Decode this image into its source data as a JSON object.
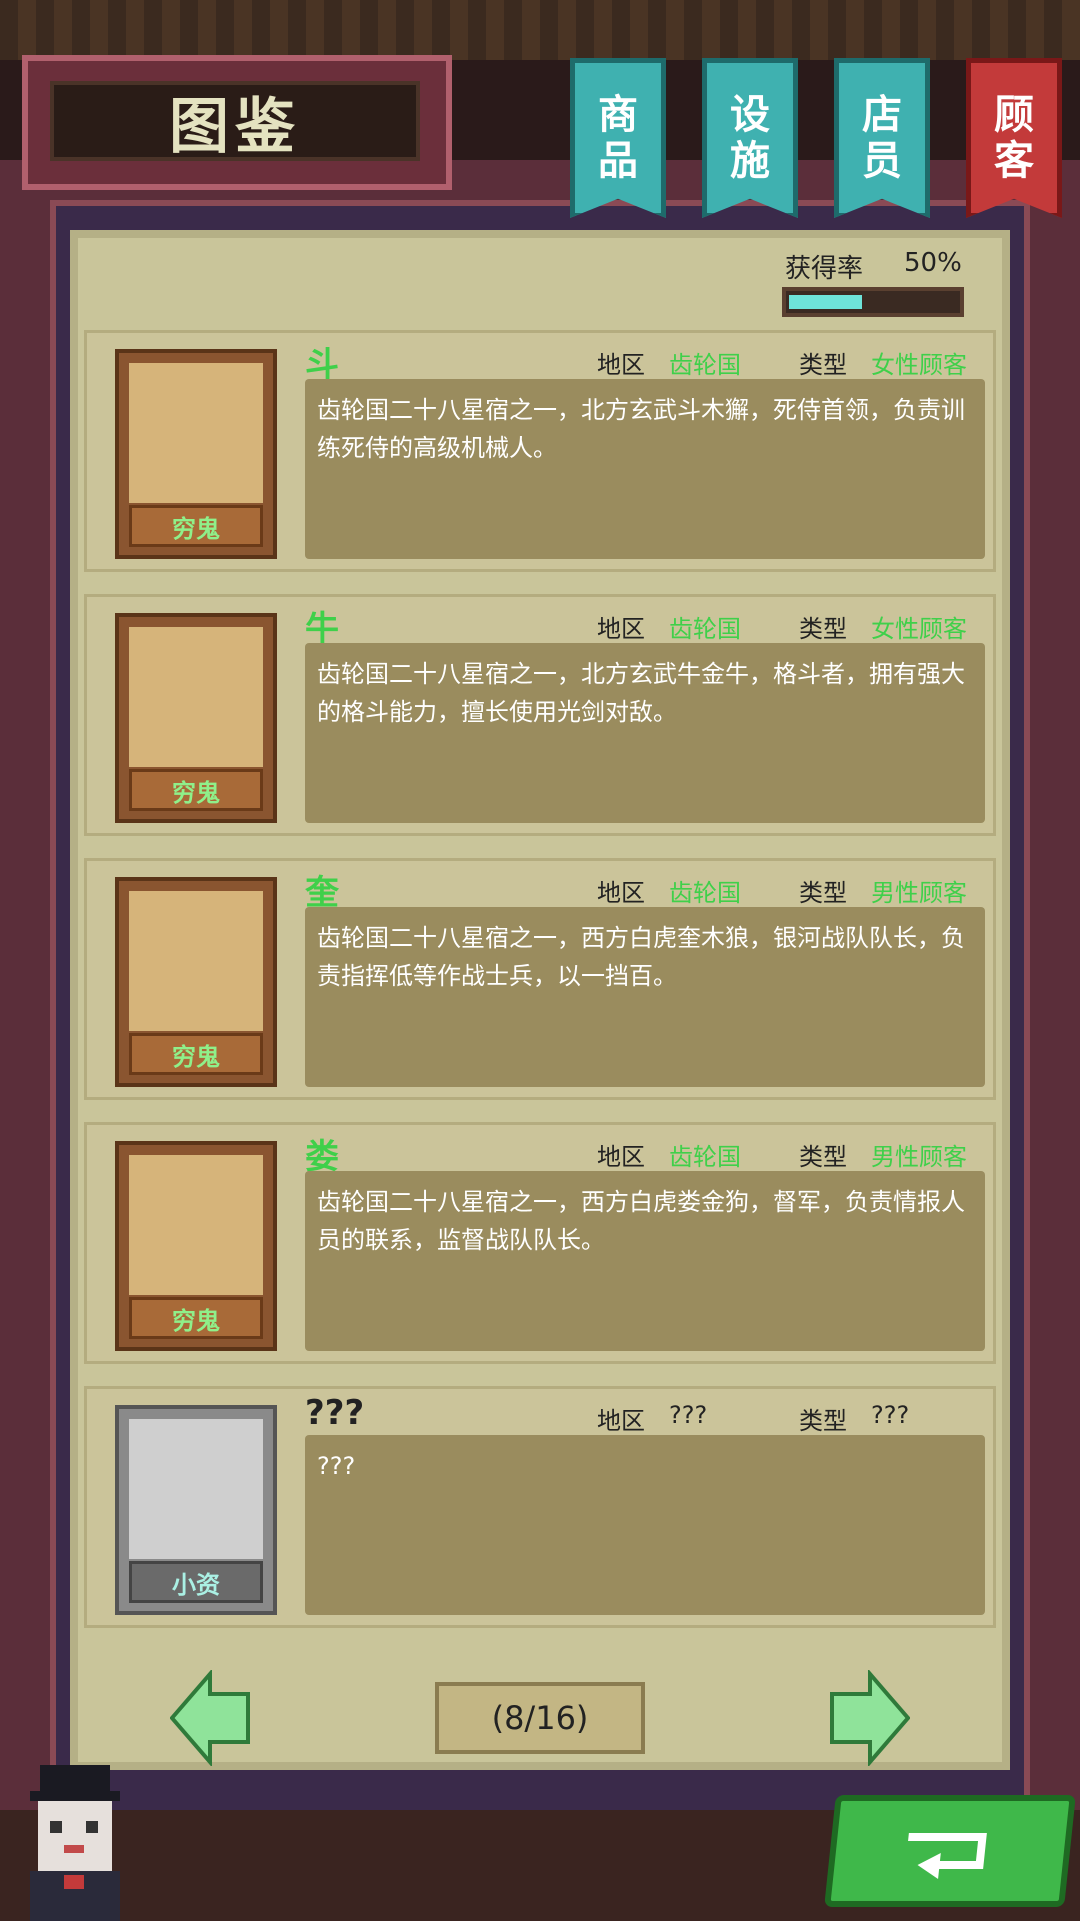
{
  "header": {
    "title": "图鉴",
    "tabs": [
      {
        "label": "商品",
        "active": false
      },
      {
        "label": "设施",
        "active": false
      },
      {
        "label": "店员",
        "active": false
      },
      {
        "label": "顾客",
        "active": true
      }
    ]
  },
  "acquire": {
    "label": "获得率",
    "value": "50%",
    "fraction": 0.5
  },
  "field_labels": {
    "region": "地区",
    "type": "类型"
  },
  "entries": [
    {
      "name": "斗",
      "region": "齿轮国",
      "type": "女性顾客",
      "tag": "穷鬼",
      "desc": "齿轮国二十八星宿之一，北方玄武斗木獬，死侍首领，负责训练死侍的高级机械人。",
      "locked": false
    },
    {
      "name": "牛",
      "region": "齿轮国",
      "type": "女性顾客",
      "tag": "穷鬼",
      "desc": "齿轮国二十八星宿之一，北方玄武牛金牛，格斗者，拥有强大的格斗能力，擅长使用光剑对敌。",
      "locked": false
    },
    {
      "name": "奎",
      "region": "齿轮国",
      "type": "男性顾客",
      "tag": "穷鬼",
      "desc": "齿轮国二十八星宿之一，西方白虎奎木狼，银河战队队长，负责指挥低等作战士兵，以一挡百。",
      "locked": false
    },
    {
      "name": "娄",
      "region": "齿轮国",
      "type": "男性顾客",
      "tag": "穷鬼",
      "desc": "齿轮国二十八星宿之一，西方白虎娄金狗，督军，负责情报人员的联系，监督战队队长。",
      "locked": false
    },
    {
      "name": "???",
      "region": "???",
      "type": "???",
      "tag": "小资",
      "desc": "???",
      "locked": true
    }
  ],
  "pager": {
    "text": "(8/16)"
  },
  "icons": {
    "prev": "left-arrow-icon",
    "next": "right-arrow-icon",
    "back": "return-arrow-icon"
  },
  "colors": {
    "accent_green": "#3fd04a",
    "tab_teal": "#3fb1b0",
    "tab_active_red": "#c33a3a"
  }
}
